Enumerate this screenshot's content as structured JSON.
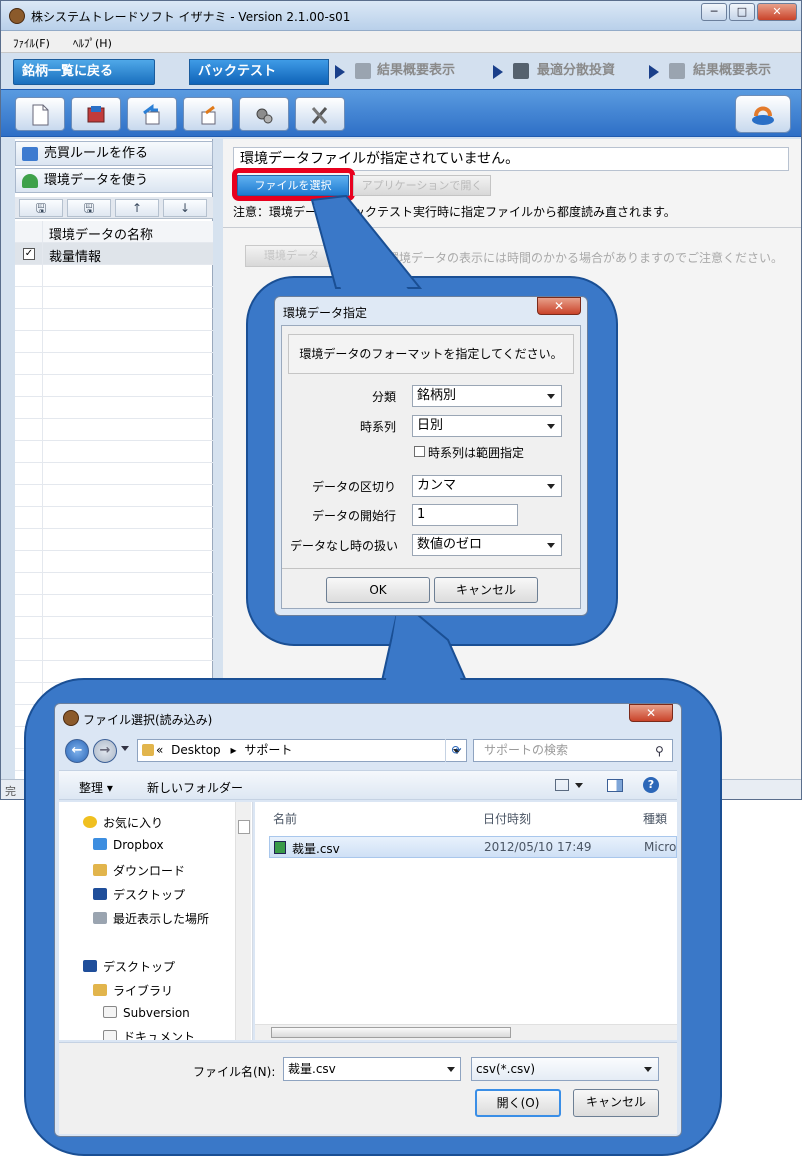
{
  "app": {
    "title": "株システムトレードソフト イザナミ - Version 2.1.00-s01",
    "min": "─",
    "max": "□",
    "close": "✕"
  },
  "menu": [
    "ﾌｧｲﾙ(F)",
    "ﾍﾙﾌﾟ(H)"
  ],
  "tabs": {
    "back": "銘柄一覧に戻る",
    "backtest": "バックテスト",
    "summary1": "結果概要表示",
    "optimize": "最適分散投資",
    "summary2": "結果概要表示"
  },
  "left": {
    "rule_btn": "売買ルールを作る",
    "env_btn": "環境データを使う",
    "tool_save": "🖫",
    "tool_save2": "🖫",
    "tool_up": "↑",
    "tool_down": "↓",
    "col_header": "環境データの名称",
    "row1": "裁量情報",
    "row1_checked": "✓"
  },
  "right": {
    "env_field": "環境データファイルが指定されていません。",
    "select_file": "ファイルを選択",
    "open_app": "アプリケーションで開く",
    "note": "注意：環境データはバックテスト実行時に指定ファイルから都度読み直されます。",
    "env_show": "環境データ",
    "env_show_note": "環境データの表示には時間のかかる場合がありますのでご注意ください。"
  },
  "status": "完",
  "dialog1": {
    "title": "環境データ指定",
    "close": "✕",
    "message": "環境データのフォーマットを指定してください。",
    "category_label": "分類",
    "category_value": "銘柄別",
    "timeseries_label": "時系列",
    "timeseries_value": "日別",
    "range_label": "時系列は範囲指定",
    "delimiter_label": "データの区切り",
    "delimiter_value": "カンマ",
    "start_label": "データの開始行",
    "start_value": "1",
    "nodata_label": "データなし時の扱い",
    "nodata_value": "数値のゼロ",
    "ok": "OK",
    "cancel": "キャンセル"
  },
  "dialog2": {
    "title": "ファイル選択(読み込み)",
    "close": "✕",
    "back": "←",
    "forward": "→",
    "addr_root": "«",
    "addr_desktop": "Desktop",
    "addr_sep": "▸",
    "addr_folder": "サポート",
    "search_placeholder": "サポートの検索",
    "organize": "整理 ▾",
    "new_folder": "新しいフォルダー",
    "nav": {
      "favorites": "お気に入り",
      "dropbox": "Dropbox",
      "downloads": "ダウンロード",
      "desktop_fav": "デスクトップ",
      "recent": "最近表示した場所",
      "desktop": "デスクトップ",
      "library": "ライブラリ",
      "subversion": "Subversion",
      "documents": "ドキュメント"
    },
    "col_name": "名前",
    "col_date": "日付時刻",
    "col_type": "種類",
    "file_name": "裁量.csv",
    "file_date": "2012/05/10 17:49",
    "file_type": "Micro",
    "fname_label": "ファイル名(N):",
    "fname_value": "裁量.csv",
    "ftype_value": "csv(*.csv)",
    "open": "開く(O)",
    "cancel": "キャンセル"
  },
  "colors": {
    "accent": "#1a6fbe",
    "highlight": "#e8001e",
    "bubble": "#3a78c8"
  }
}
